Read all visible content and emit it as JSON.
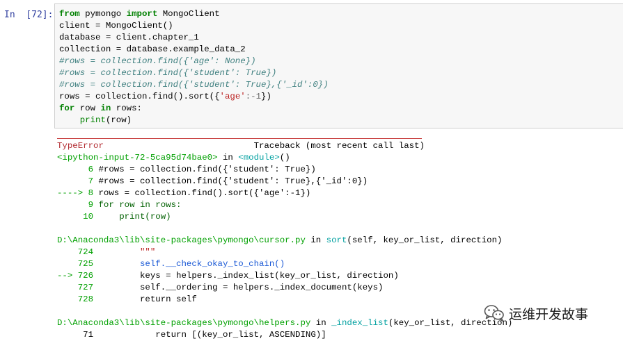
{
  "prompt": "In  [72]:",
  "code": {
    "line1": [
      "from",
      " pymongo ",
      "import",
      " MongoClient"
    ],
    "line2": "client = MongoClient()",
    "line3": "database = client.chapter_1",
    "line4": "collection = database.example_data_2",
    "line5": "#rows = collection.find({'age': None})",
    "line6": "#rows = collection.find({'student': True})",
    "line7": "#rows = collection.find({'student': True},{'_id':0})",
    "line8": [
      "rows = collection.find().sort({",
      "'age'",
      ":",
      "-1",
      "})"
    ],
    "line9": [
      "for",
      " row ",
      "in",
      " rows:"
    ],
    "line10": [
      "    ",
      "print",
      "(row)"
    ]
  },
  "traceback": {
    "error_type": "TypeError",
    "traceback_header": "Traceback (most recent call last)",
    "input_ref": [
      "<ipython-input-72-5ca95d74bae0>",
      " in ",
      "<module>",
      "()"
    ],
    "frame1": [
      {
        "num": "      6",
        "text": " #rows = collection.find({'student': True})"
      },
      {
        "num": "      7",
        "text": " #rows = collection.find({'student': True},{'_id':0})"
      },
      {
        "arrow": "----> 8",
        "text": " rows = collection.find().sort({'age':-1})"
      },
      {
        "num": "      9",
        "text": " for row in rows:"
      },
      {
        "num": "     10",
        "text": "     print(row)"
      }
    ],
    "file2": [
      "D:\\Anaconda3\\lib\\site-packages\\pymongo\\cursor.py",
      " in ",
      "sort",
      "(self, key_or_list, direction)"
    ],
    "frame2": [
      {
        "num": "    724",
        "text": "         \"\"\""
      },
      {
        "num": "    725",
        "text": "         self.__check_okay_to_chain()"
      },
      {
        "arrow": "--> 726",
        "text": "         keys = helpers._index_list(key_or_list, direction)"
      },
      {
        "num": "    727",
        "text": "         self.__ordering = helpers._index_document(keys)"
      },
      {
        "num": "    728",
        "text": "         return self"
      }
    ],
    "file3": [
      "D:\\Anaconda3\\lib\\site-packages\\pymongo\\helpers.py",
      " in ",
      "_index_list",
      "(key_or_list, direction)"
    ],
    "cutoff": "     71            return [(key_or_list, ASCENDING)]"
  },
  "watermark": {
    "icon": "wechat-icon",
    "text": "运维开发故事"
  }
}
